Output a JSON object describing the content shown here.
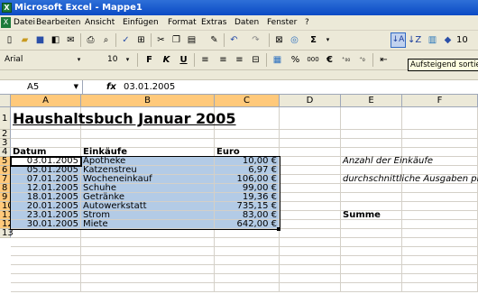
{
  "window": {
    "title": "Microsoft Excel - Mappe1",
    "app_icon": "excel-icon"
  },
  "menu": [
    "Datei",
    "Bearbeiten",
    "Ansicht",
    "Einfügen",
    "Format",
    "Extras",
    "Daten",
    "Fenster",
    "?"
  ],
  "toolbar": {
    "font_name": "Arial",
    "font_size": "10",
    "bold": "F",
    "italic": "K",
    "underline": "U",
    "euro": "€",
    "percent": "%",
    "thousands": "000",
    "zoom": "10",
    "sum": "Σ",
    "tooltip": "Aufsteigend sortieren"
  },
  "formula_bar": {
    "cell_ref": "A5",
    "fx": "fx",
    "value": "03.01.2005"
  },
  "columns": [
    "A",
    "B",
    "C",
    "D",
    "E",
    "F"
  ],
  "rows": [
    "1",
    "2",
    "3",
    "4",
    "5",
    "6",
    "7",
    "8",
    "9",
    "10",
    "11",
    "12",
    "13"
  ],
  "sheet": {
    "title": "Haushaltsbuch Januar 2005",
    "headers": {
      "datum": "Datum",
      "einkaeufe": "Einkäufe",
      "euro": "Euro"
    },
    "entries": [
      {
        "datum": "03.01.2005",
        "einkauf": "Apotheke",
        "euro": "10,00 €"
      },
      {
        "datum": "05.01.2005",
        "einkauf": "Katzenstreu",
        "euro": "6,97 €"
      },
      {
        "datum": "07.01.2005",
        "einkauf": "Wocheneinkauf",
        "euro": "106,00 €"
      },
      {
        "datum": "12.01.2005",
        "einkauf": "Schuhe",
        "euro": "99,00 €"
      },
      {
        "datum": "18.01.2005",
        "einkauf": "Getränke",
        "euro": "19,36 €"
      },
      {
        "datum": "20.01.2005",
        "einkauf": "Autowerkstatt",
        "euro": "735,15 €"
      },
      {
        "datum": "23.01.2005",
        "einkauf": "Strom",
        "euro": "83,00 €"
      },
      {
        "datum": "30.01.2005",
        "einkauf": "Miete",
        "euro": "642,00 €"
      }
    ],
    "labels": {
      "anzahl": "Anzahl der Einkäufe",
      "durchschnitt": "durchschnittliche Ausgaben pro",
      "summe": "Summe"
    }
  },
  "colors": {
    "selection": "#b3cbe6",
    "header_highlight": "#ffc97b",
    "titlebar": "#0a4ac4"
  }
}
